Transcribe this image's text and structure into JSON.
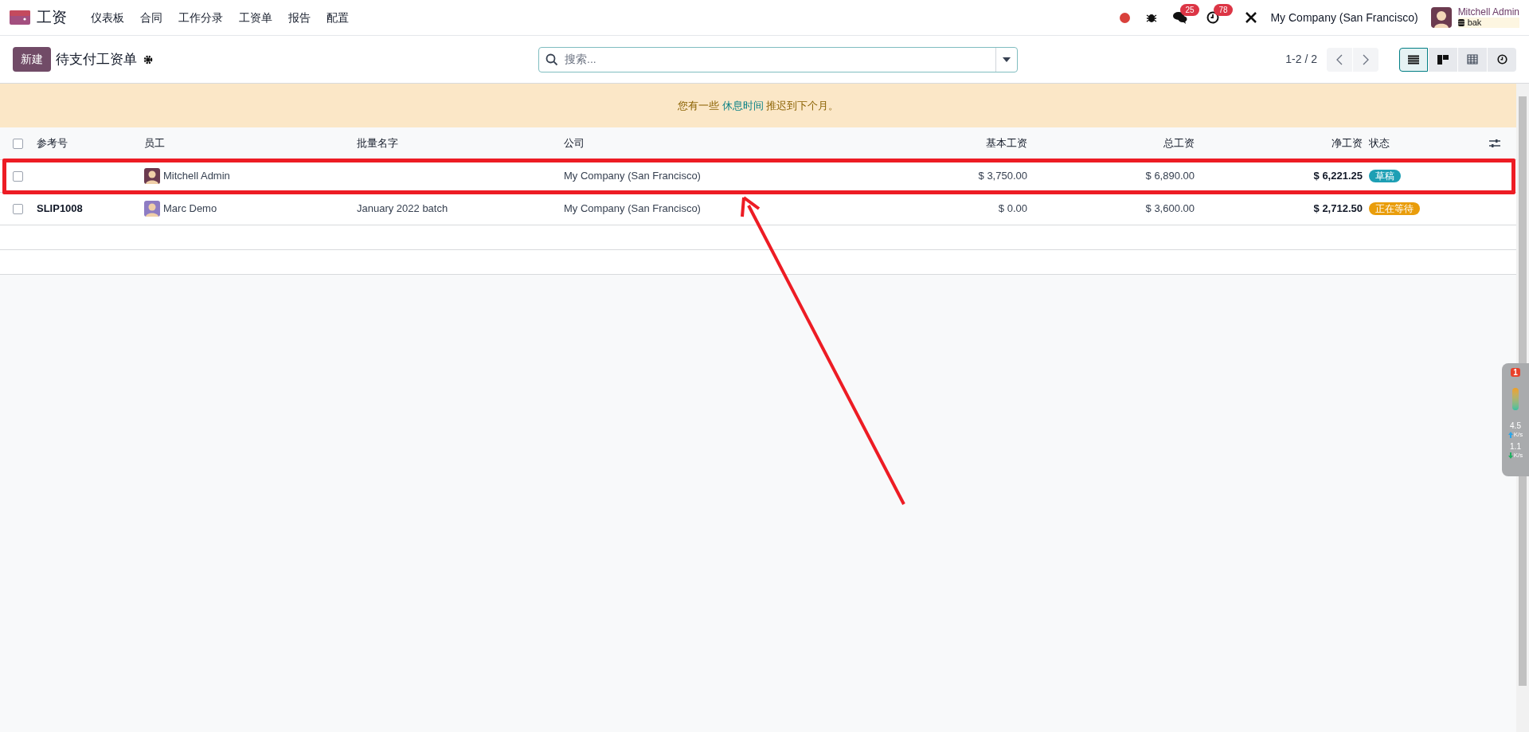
{
  "app": {
    "name": "工资",
    "menu": [
      "仪表板",
      "合同",
      "工作分录",
      "工资单",
      "报告",
      "配置"
    ]
  },
  "systray": {
    "messages_count": "25",
    "activities_count": "78",
    "company": "My Company (San Francisco)",
    "user": "Mitchell Admin",
    "database": "bak"
  },
  "control_panel": {
    "new_button": "新建",
    "title": "待支付工资单",
    "search": {
      "placeholder": "搜索..."
    },
    "pager": "1-2 / 2",
    "views": [
      {
        "kind": "list",
        "selected": true
      },
      {
        "kind": "kanban",
        "selected": false
      },
      {
        "kind": "pivot",
        "selected": false
      },
      {
        "kind": "activity",
        "selected": false
      }
    ]
  },
  "alert": {
    "before": "您有一些",
    "link": "休息时间",
    "after": "推迟到下个月。"
  },
  "table": {
    "select_all_checked": false,
    "columns": [
      "参考号",
      "员工",
      "批量名字",
      "公司",
      "基本工资",
      "总工资",
      "净工资",
      "状态"
    ],
    "rows": [
      {
        "reference": "",
        "employee": "Mitchell Admin",
        "batch": "",
        "company": "My Company (San Francisco)",
        "basic": "$ 3,750.00",
        "gross": "$ 6,890.00",
        "net": "$ 6,221.25",
        "status": "草稿",
        "color": "#1d9fb4",
        "checked": false
      },
      {
        "reference": "SLIP1008",
        "employee": "Marc Demo",
        "batch": "January 2022 batch",
        "company": "My Company (San Francisco)",
        "basic": "$ 0.00",
        "gross": "$ 3,600.00",
        "net": "$ 2,712.50",
        "status": "正在等待",
        "color": "#e99d0b",
        "checked": false
      }
    ]
  },
  "speed_widget": {
    "alerts": "1",
    "upload": "4.5",
    "upload_unit": "K/s",
    "download": "1.1",
    "download_unit": "K/s"
  }
}
